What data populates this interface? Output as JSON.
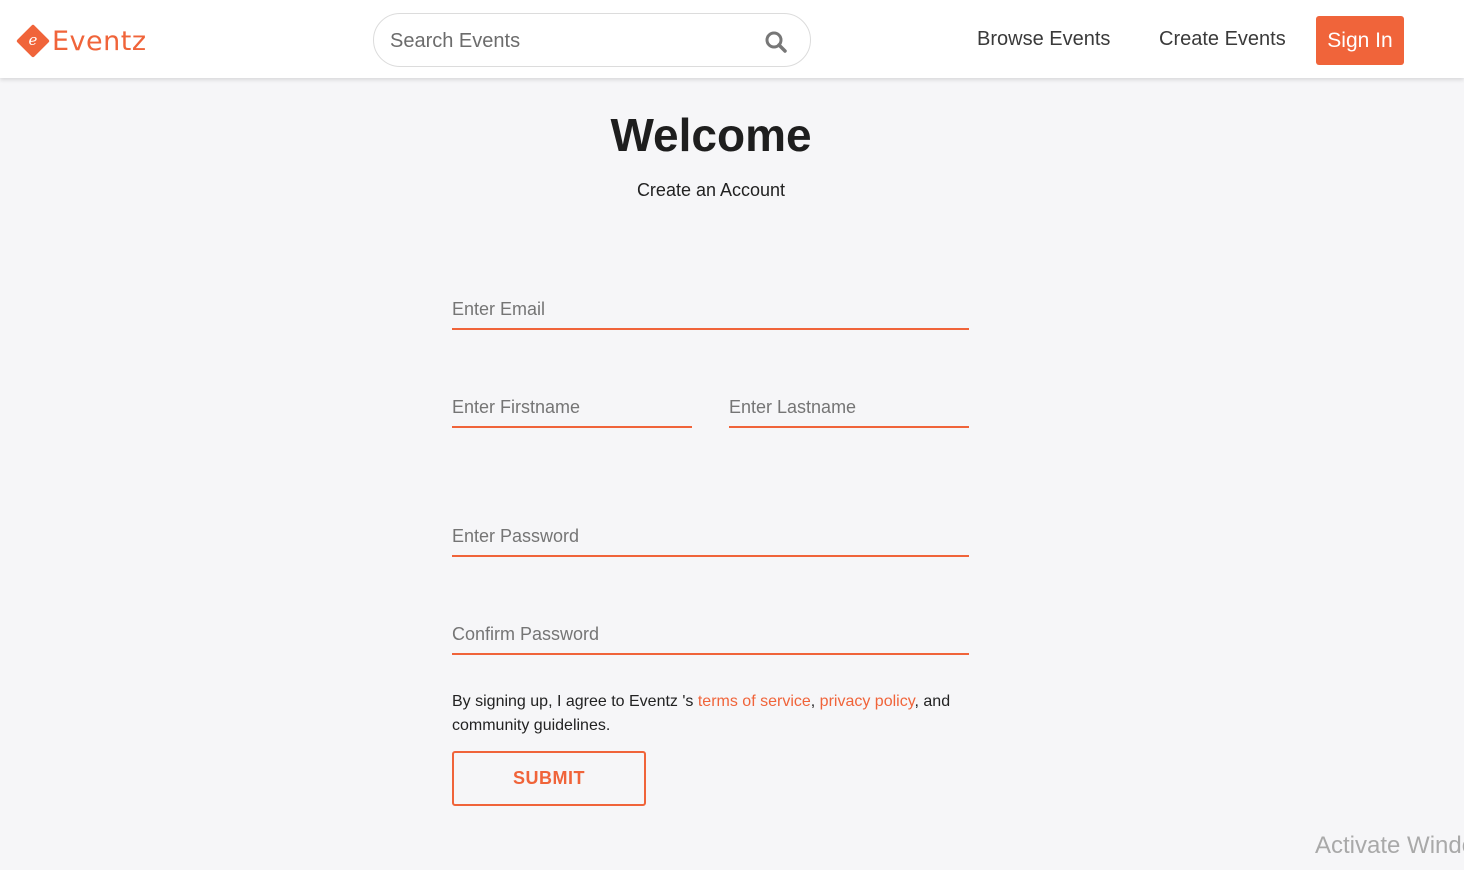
{
  "brand": {
    "name": "Eventz",
    "logo_letter": "e",
    "accent_color": "#f0643a"
  },
  "header": {
    "search_placeholder": "Search Events",
    "search_icon": "search-icon",
    "nav": {
      "browse": "Browse Events",
      "create": "Create Events",
      "signin": "Sign In"
    }
  },
  "main": {
    "title": "Welcome",
    "subtitle": "Create an Account",
    "form": {
      "email_placeholder": "Enter Email",
      "firstname_placeholder": "Enter Firstname",
      "lastname_placeholder": "Enter Lastname",
      "password_placeholder": "Enter Password",
      "confirm_placeholder": "Confirm Password",
      "terms": {
        "prefix": "By signing up, I agree to Eventz 's ",
        "tos_link": "terms of service",
        "sep": ", ",
        "privacy_link": "privacy policy",
        "suffix": ", and community guidelines."
      },
      "submit": "SUBMIT"
    }
  },
  "overlay": {
    "watermark": "Activate Windows"
  }
}
